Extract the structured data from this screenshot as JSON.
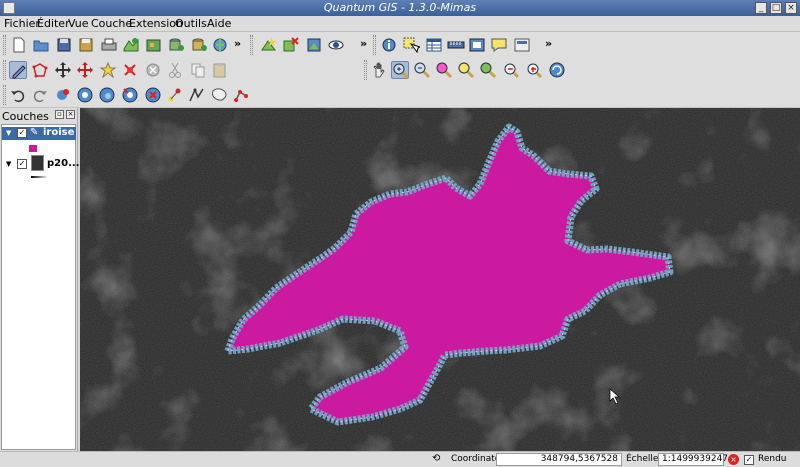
{
  "window": {
    "title": "Quantum GIS - 1.3.0-Mimas"
  },
  "menu": [
    "Fichier",
    "Éditer",
    "Vue",
    "Couche",
    "Extension",
    "Outils",
    "Aide"
  ],
  "toolbar_more": "»",
  "layers_panel": {
    "title": "Couches",
    "layers": [
      {
        "name": "iroise",
        "checked": true,
        "selected": true
      },
      {
        "name": "p20...",
        "checked": true,
        "selected": false
      }
    ]
  },
  "statusbar": {
    "coordinate_label": "Coordinate:",
    "coordinate_value": "348794,5367528",
    "scale_label": "Échelle",
    "scale_value": "1:1499939247",
    "render_label": "Rendu",
    "render_checked": true
  },
  "colors": {
    "polygon_fill": "#cc1aa0",
    "polygon_outline": "#6fa3c0",
    "map_background": "#262626",
    "titlebar": "#4a6fa8"
  }
}
